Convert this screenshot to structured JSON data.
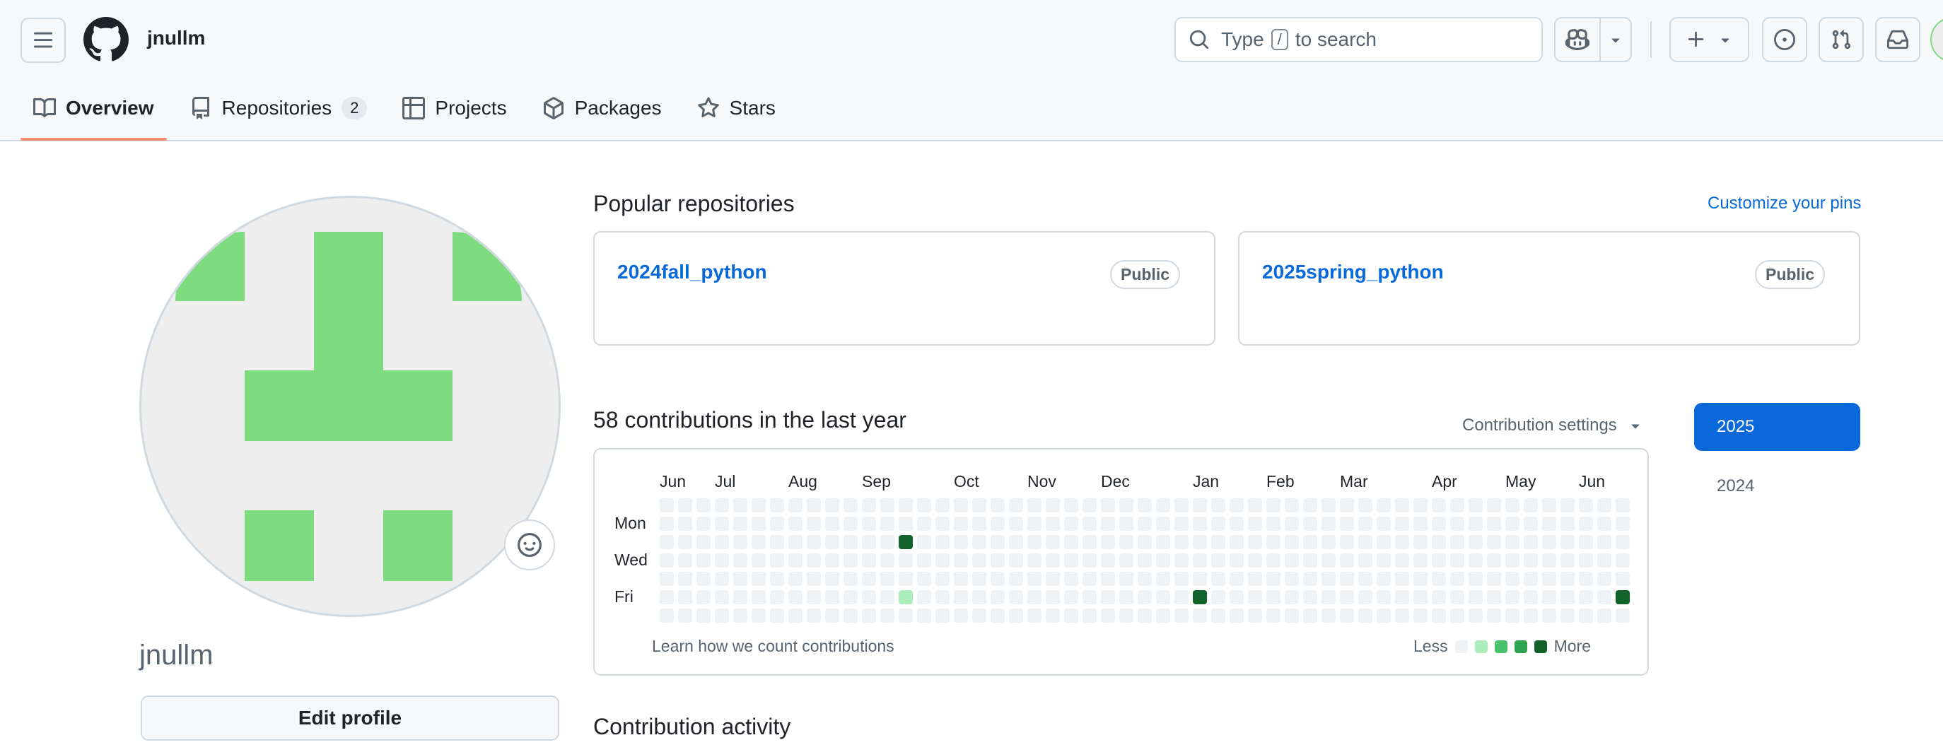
{
  "header": {
    "username": "jnullm",
    "search": {
      "prefix": "Type",
      "key": "/",
      "suffix": "to search"
    },
    "icons": {
      "menu": "hamburger-icon",
      "logo": "github-mark-icon",
      "search": "search-icon",
      "copilot": "copilot-icon",
      "dropdown": "triangle-down-icon",
      "create": "plus-icon",
      "issues": "issue-opened-icon",
      "pulls": "git-pull-request-icon",
      "inbox": "inbox-icon"
    }
  },
  "tabs": [
    {
      "label": "Overview",
      "icon": "book-icon",
      "active": true
    },
    {
      "label": "Repositories",
      "icon": "repo-icon",
      "counter": "2"
    },
    {
      "label": "Projects",
      "icon": "table-icon"
    },
    {
      "label": "Packages",
      "icon": "package-icon"
    },
    {
      "label": "Stars",
      "icon": "star-icon"
    }
  ],
  "profile": {
    "name": "jnullm",
    "edit_label": "Edit profile",
    "avatar_color": "#7ddb80",
    "status_icon": "smiley-icon"
  },
  "pinned": {
    "title": "Popular repositories",
    "customize": "Customize your pins",
    "repos": [
      {
        "name": "2024fall_python",
        "visibility": "Public"
      },
      {
        "name": "2025spring_python",
        "visibility": "Public"
      }
    ]
  },
  "contributions": {
    "title": "58 contributions in the last year",
    "settings_label": "Contribution settings",
    "months": [
      "Jun",
      "Jul",
      "Aug",
      "Sep",
      "Oct",
      "Nov",
      "Dec",
      "Jan",
      "Feb",
      "Mar",
      "Apr",
      "May",
      "Jun"
    ],
    "days": [
      "Mon",
      "Wed",
      "Fri"
    ],
    "learn": "Learn how we count contributions",
    "less": "Less",
    "more": "More",
    "colors": [
      "#eff2f5",
      "#aceebb",
      "#4ac26b",
      "#2da44e",
      "#116329"
    ],
    "weeks": 53,
    "highlighted": [
      {
        "week": 13,
        "day": 2,
        "level": 4
      },
      {
        "week": 13,
        "day": 5,
        "level": 1
      },
      {
        "week": 29,
        "day": 5,
        "level": 4
      },
      {
        "week": 52,
        "day": 5,
        "level": 4
      }
    ]
  },
  "activity": {
    "title": "Contribution activity"
  },
  "years": [
    "2025",
    "2024"
  ]
}
